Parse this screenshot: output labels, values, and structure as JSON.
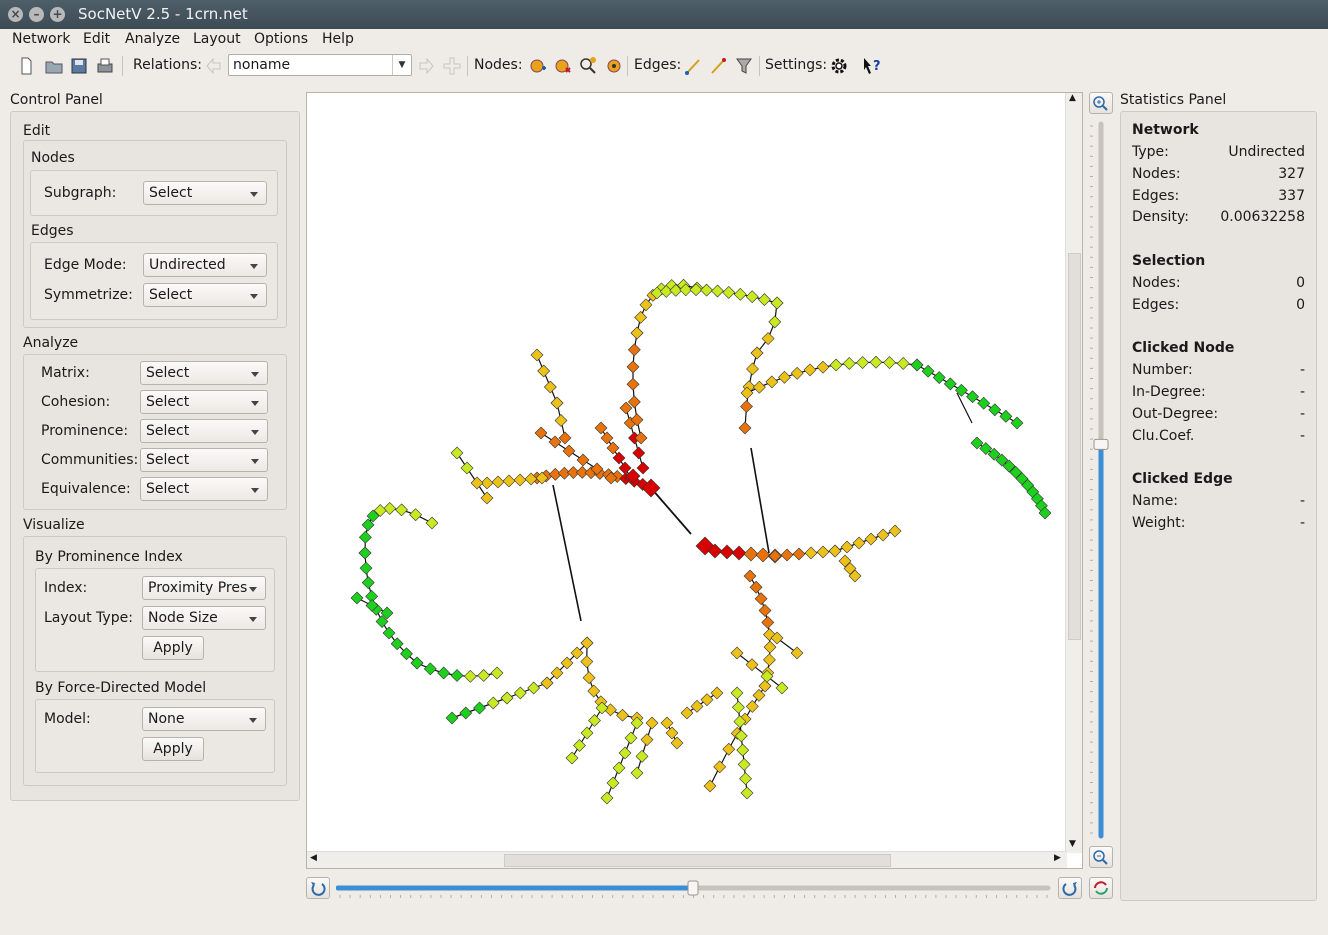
{
  "window": {
    "title": "SocNetV 2.5 - 1crn.net",
    "close_glyph": "×",
    "min_glyph": "–",
    "max_glyph": "+"
  },
  "menu": [
    "Network",
    "Edit",
    "Analyze",
    "Layout",
    "Options",
    "Help"
  ],
  "toolbar": {
    "relations_label": "Relations:",
    "relation_value": "noname",
    "nodes_label": "Nodes:",
    "edges_label": "Edges:",
    "settings_label": "Settings:"
  },
  "control_panel": {
    "title": "Control Panel",
    "edit_title": "Edit",
    "nodes_title": "Nodes",
    "subgraph_label": "Subgraph:",
    "subgraph_value": "Select",
    "edges_title": "Edges",
    "edge_mode_label": "Edge Mode:",
    "edge_mode_value": "Undirected",
    "symmetrize_label": "Symmetrize:",
    "symmetrize_value": "Select",
    "analyze_title": "Analyze",
    "matrix_label": "Matrix:",
    "matrix_value": "Select",
    "cohesion_label": "Cohesion:",
    "cohesion_value": "Select",
    "prominence_label": "Prominence:",
    "prominence_value": "Select",
    "communities_label": "Communities:",
    "communities_value": "Select",
    "equivalence_label": "Equivalence:",
    "equivalence_value": "Select",
    "visualize_title": "Visualize",
    "by_prominence_title": "By Prominence Index",
    "index_label": "Index:",
    "index_value": "Proximity Pres",
    "layout_type_label": "Layout Type:",
    "layout_type_value": "Node Size",
    "apply_label": "Apply",
    "force_title": "By Force-Directed Model",
    "model_label": "Model:",
    "model_value": "None",
    "apply2_label": "Apply"
  },
  "statistics": {
    "title": "Statistics Panel",
    "network_head": "Network",
    "type_label": "Type:",
    "type_value": "Undirected",
    "nodes_label": "Nodes:",
    "nodes_value": "327",
    "edges_label": "Edges:",
    "edges_value": "337",
    "density_label": "Density:",
    "density_value": "0.00632258",
    "selection_head": "Selection",
    "sel_nodes_label": "Nodes:",
    "sel_nodes_value": "0",
    "sel_edges_label": "Edges:",
    "sel_edges_value": "0",
    "clicked_node_head": "Clicked Node",
    "number_label": "Number:",
    "number_value": "-",
    "indegree_label": "In-Degree:",
    "indegree_value": "-",
    "outdegree_label": "Out-Degree:",
    "outdegree_value": "-",
    "clucoef_label": "Clu.Coef.",
    "clucoef_value": "-",
    "clicked_edge_head": "Clicked Edge",
    "name_label": "Name:",
    "name_value": "-",
    "weight_label": "Weight:",
    "weight_value": "-"
  },
  "view": {
    "zoom_level": 0.55,
    "rotation_level": 0.5
  },
  "colors": {
    "hub": "#d80000",
    "near": "#e8720c",
    "mid": "#ecc21a",
    "far": "#c8ea22",
    "farthest": "#1ed01e"
  }
}
